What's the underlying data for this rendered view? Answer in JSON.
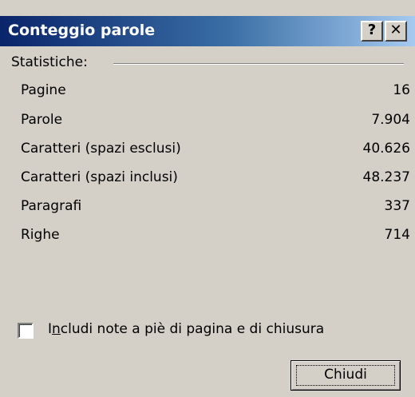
{
  "window": {
    "title": "Conteggio parole",
    "help_button": "?",
    "close_button": "✕"
  },
  "statistics": {
    "group_label": "Statistiche:",
    "rows": [
      {
        "label": "Pagine",
        "value": "16"
      },
      {
        "label": "Parole",
        "value": "7.904"
      },
      {
        "label": "Caratteri (spazi esclusi)",
        "value": "40.626"
      },
      {
        "label": "Caratteri (spazi inclusi)",
        "value": "48.237"
      },
      {
        "label": "Paragrafi",
        "value": "337"
      },
      {
        "label": "Righe",
        "value": "714"
      }
    ]
  },
  "options": {
    "include_notes_prefix": "I",
    "include_notes_accel": "n",
    "include_notes_rest": "cludi note a piè di pagina e di chiusura",
    "include_notes_checked": false
  },
  "buttons": {
    "close_label": "Chiudi"
  },
  "colors": {
    "titlebar_start": "#0a246a",
    "titlebar_end": "#a6caf0",
    "dialog_bg": "#d4d0c8"
  }
}
